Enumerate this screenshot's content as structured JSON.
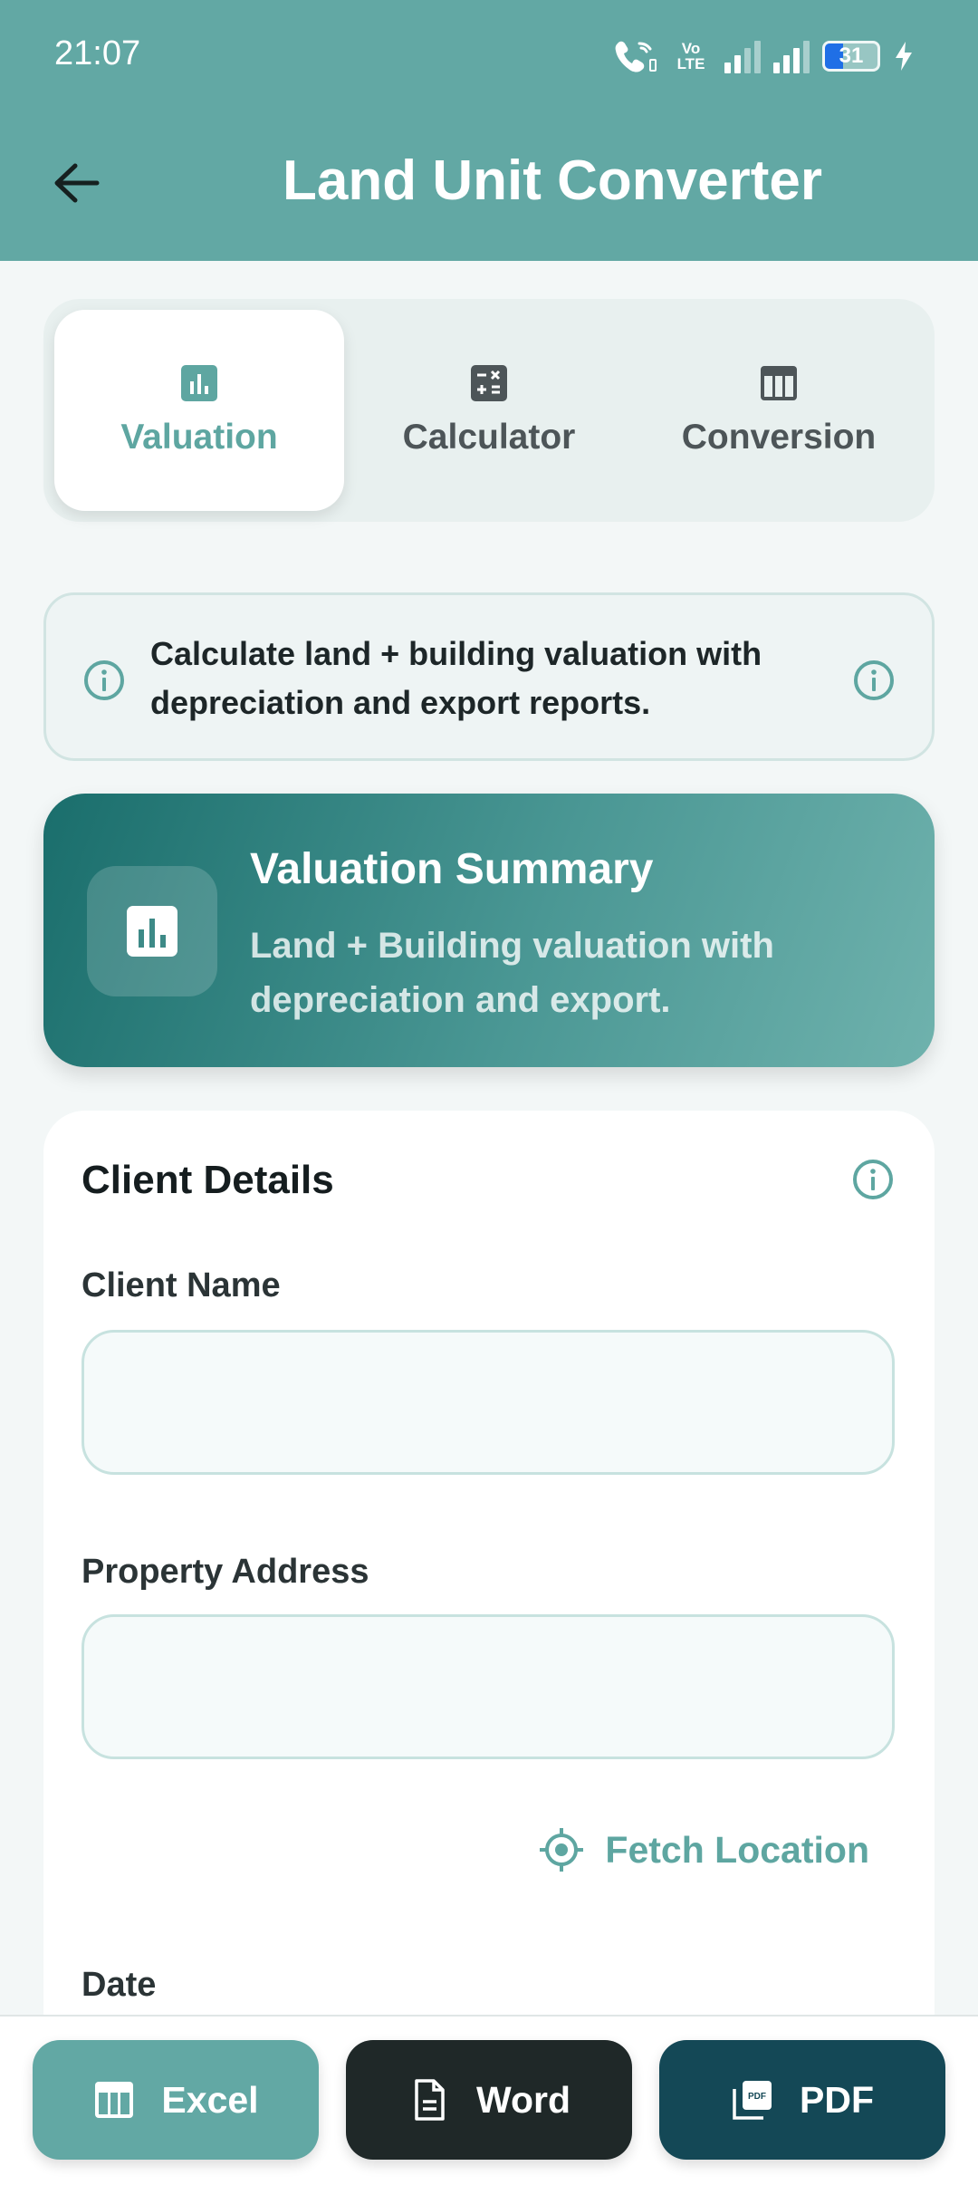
{
  "status_bar": {
    "time": "21:07",
    "volte_top": "Vo",
    "volte_bottom": "LTE",
    "battery": "31"
  },
  "header": {
    "title": "Land Unit Converter",
    "back_icon": "arrow-left-icon"
  },
  "tabs": [
    {
      "label": "Valuation",
      "icon": "bar-chart-icon",
      "active": true
    },
    {
      "label": "Calculator",
      "icon": "calculator-icon",
      "active": false
    },
    {
      "label": "Conversion",
      "icon": "table-icon",
      "active": false
    }
  ],
  "info_banner": {
    "text": "Calculate land + building valuation with depreciation and export reports."
  },
  "summary": {
    "title": "Valuation Summary",
    "subtitle": "Land + Building valuation with depreciation and export."
  },
  "client_details": {
    "title": "Client Details",
    "client_name_label": "Client Name",
    "client_name_value": "",
    "property_address_label": "Property Address",
    "property_address_value": "",
    "fetch_location_label": "Fetch Location",
    "date_label": "Date"
  },
  "export_buttons": {
    "excel": "Excel",
    "word": "Word",
    "pdf": "PDF"
  },
  "colors": {
    "primary": "#62a8a4",
    "dark": "#1f2828",
    "pdf": "#144856",
    "summary_gradient_start": "#1a6e6c",
    "summary_gradient_end": "#6fb2ad"
  }
}
